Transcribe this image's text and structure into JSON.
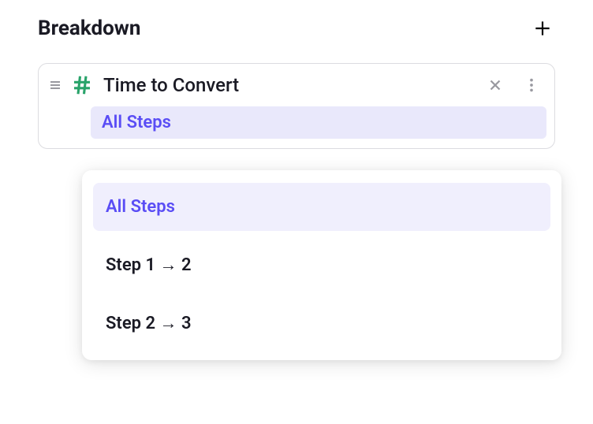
{
  "header": {
    "title": "Breakdown"
  },
  "card": {
    "title": "Time to Convert",
    "selected_step": "All Steps"
  },
  "dropdown": {
    "items": [
      {
        "label": "All Steps",
        "selected": true
      },
      {
        "label": "Step 1 → 2",
        "selected": false
      },
      {
        "label": "Step 2 → 3",
        "selected": false
      }
    ]
  }
}
